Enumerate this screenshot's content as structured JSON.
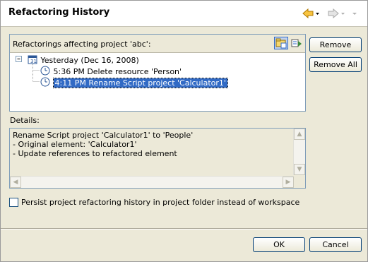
{
  "dialog": {
    "title": "Refactoring History"
  },
  "nav": {
    "back_icon": "back-arrow-icon",
    "forward_icon": "forward-arrow-icon",
    "back_color": "#e8a200",
    "forward_color": "#c0c0c0"
  },
  "history": {
    "label": "Refactorings affecting project 'abc':",
    "group_label": "Yesterday (Dec 16, 2008)",
    "items": [
      {
        "label": "5:36 PM Delete resource 'Person'",
        "selected": false
      },
      {
        "label": "4:11 PM Rename Script project 'Calculator1'",
        "selected": true
      }
    ]
  },
  "buttons": {
    "remove": "Remove",
    "remove_all": "Remove All",
    "ok": "OK",
    "cancel": "Cancel"
  },
  "details": {
    "label": "Details:",
    "lines": [
      "Rename Script project 'Calculator1' to 'People'",
      "- Original element: 'Calculator1'",
      "- Update references to refactored element"
    ]
  },
  "persist": {
    "label": "Persist project refactoring history in project folder instead of workspace",
    "checked": false
  },
  "colors": {
    "selection": "#316ac5",
    "dialog_bg": "#ece9d8",
    "border": "#7f9db9"
  }
}
